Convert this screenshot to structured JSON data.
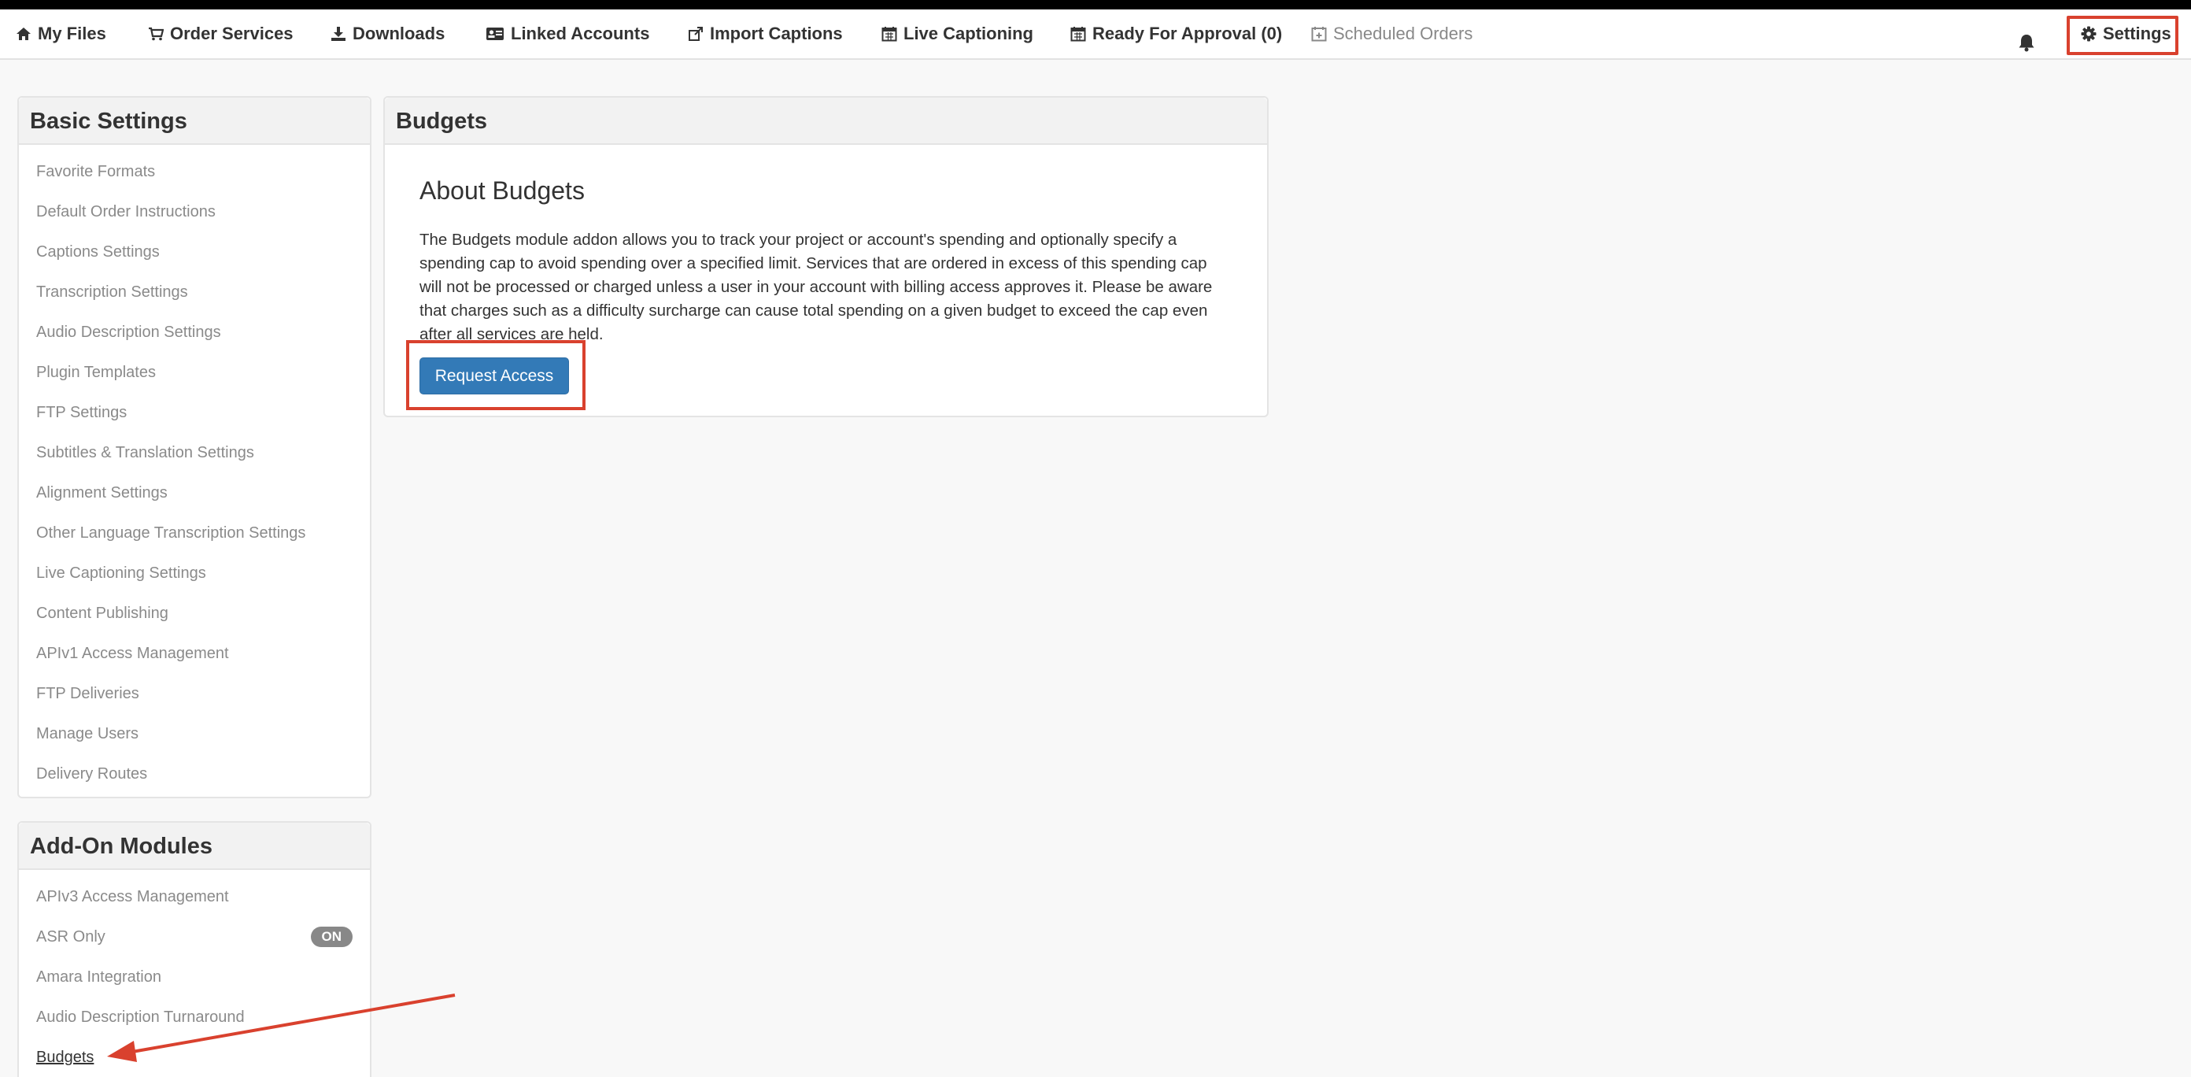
{
  "nav": {
    "items": [
      {
        "label": "My Files",
        "icon": "home-icon"
      },
      {
        "label": "Order Services",
        "icon": "cart-icon"
      },
      {
        "label": "Downloads",
        "icon": "download-icon"
      },
      {
        "label": "Linked Accounts",
        "icon": "id-card-icon"
      },
      {
        "label": "Import Captions",
        "icon": "share-icon"
      },
      {
        "label": "Live Captioning",
        "icon": "calendar-icon"
      },
      {
        "label": "Ready For Approval (0)",
        "icon": "calendar-icon"
      },
      {
        "label": "Scheduled Orders",
        "icon": "calendar-plus-icon"
      }
    ],
    "notifications_icon": "bell-icon",
    "settings_label": "Settings",
    "settings_icon": "gear-icon"
  },
  "basic_settings": {
    "title": "Basic Settings",
    "items": [
      "Favorite Formats",
      "Default Order Instructions",
      "Captions Settings",
      "Transcription Settings",
      "Audio Description Settings",
      "Plugin Templates",
      "FTP Settings",
      "Subtitles & Translation Settings",
      "Alignment Settings",
      "Other Language Transcription Settings",
      "Live Captioning Settings",
      "Content Publishing",
      "APIv1 Access Management",
      "FTP Deliveries",
      "Manage Users",
      "Delivery Routes"
    ]
  },
  "addon_modules": {
    "title": "Add-On Modules",
    "items": [
      "APIv3 Access Management",
      "ASR Only",
      "Amara Integration",
      "Audio Description Turnaround",
      "Budgets"
    ],
    "asr_badge": "ON",
    "active_item": "Budgets"
  },
  "budgets": {
    "title": "Budgets",
    "about_title": "About Budgets",
    "description": "The Budgets module addon allows you to track your project or account's spending and optionally specify a spending cap to avoid spending over a specified limit. Services that are ordered in excess of this spending cap will not be processed or charged unless a user in your account with billing access approves it. Please be aware that charges such as a difficulty surcharge can cause total spending on a given budget to exceed the cap even after all services are held.",
    "request_button": "Request Access"
  },
  "colors": {
    "accent_blue": "#337ab7",
    "annotation_red": "#d9412e",
    "badge_gray": "#888888"
  }
}
